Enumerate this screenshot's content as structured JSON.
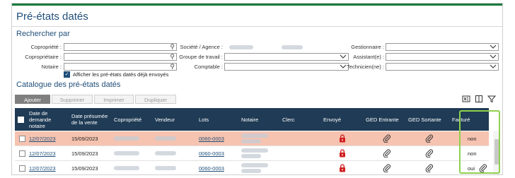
{
  "page": {
    "title": "Pré-états datés"
  },
  "search": {
    "title": "Rechercher par",
    "fields": [
      {
        "label": "Copropriété :",
        "value": ""
      },
      {
        "label": "Copropriétaire :",
        "value": ""
      },
      {
        "label": "Notaire :",
        "value": ""
      },
      {
        "label": "Société / Agence :",
        "value": ""
      },
      {
        "label": "Groupe de travail :",
        "value": ""
      },
      {
        "label": "Comptable :",
        "value": ""
      },
      {
        "label": "Gestionnaire :",
        "value": ""
      },
      {
        "label": "Assistant(e) :",
        "value": ""
      },
      {
        "label": "Technicien(ne) :",
        "value": ""
      }
    ],
    "show_sent_label": "Afficher les pré-états datés déjà envoyés",
    "show_sent_checked": true
  },
  "catalogue": {
    "title": "Catalogue des pré-états datés",
    "buttons": {
      "add": "Ajouter",
      "delete": "Supprimer",
      "print": "Imprimer",
      "duplicate": "Dupliquer"
    },
    "columns": [
      "Date de demande notaire",
      "Date présumée de la vente",
      "Copropriété",
      "Vendeur",
      "Lots",
      "Notaire",
      "Clerc",
      "Envoyé",
      "GED Entrante",
      "GED Sortante",
      "Facturé"
    ],
    "rows": [
      {
        "date_demande": "12/07/2023",
        "date_vente": "15/09/2023",
        "lots": "0060-0003",
        "facture": "non",
        "selected": true
      },
      {
        "date_demande": "12/07/2023",
        "date_vente": "15/09/2023",
        "lots": "0060-0003",
        "facture": "non",
        "selected": false
      },
      {
        "date_demande": "12/07/2023",
        "date_vente": "15/09/2023",
        "lots": "0060-0003",
        "facture": "oui",
        "selected": false
      }
    ]
  },
  "colors": {
    "header": "#1f3b55",
    "accent": "#1f4e79",
    "selected_row": "#f6c3b0",
    "lock": "#d0201f",
    "highlight": "#8fd14f"
  }
}
